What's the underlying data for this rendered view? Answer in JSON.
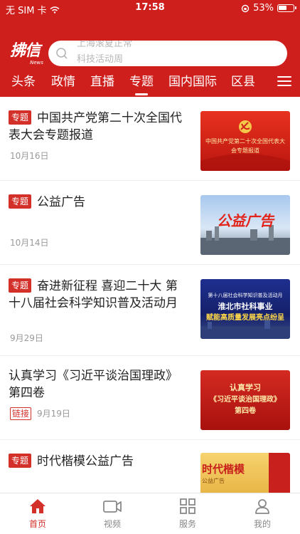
{
  "status_bar": {
    "carrier": "无 SIM 卡",
    "time": "17:58",
    "battery": "53%"
  },
  "logo": {
    "main": "拂信",
    "sub": "News"
  },
  "search": {
    "hints": [
      "上海滚夏正常",
      "科技活动周"
    ]
  },
  "nav": {
    "tabs": [
      {
        "label": "头条"
      },
      {
        "label": "政情"
      },
      {
        "label": "直播"
      },
      {
        "label": "专题"
      },
      {
        "label": "国内国际"
      },
      {
        "label": "区县"
      }
    ],
    "active": "专题"
  },
  "news": [
    {
      "badge": "专题",
      "title": "中国共产党第二十次全国代表大会专题报道",
      "date": "10月16日",
      "thumb": {
        "caption": "中国共产党第二十次全国代表大会专题报道",
        "bg": "#cf2418"
      }
    },
    {
      "badge": "专题",
      "title": "公益广告",
      "date": "10月14日",
      "thumb": {
        "caption": "公益广告",
        "bg": "#9fbfe6"
      }
    },
    {
      "badge": "专题",
      "title": "奋进新征程 喜迎二十大 第十八届社会科学知识普及活动月",
      "date": "9月29日",
      "thumb": {
        "caption_top": "第十八届社会科学知识普及活动月",
        "caption_main": "淮北市社科事业",
        "caption_sub": "赋能高质量发展亮点纷呈",
        "bg": "#1b2a7a"
      }
    },
    {
      "badge": "",
      "title": "认真学习《习近平谈治国理政》第四卷",
      "tag": "链接",
      "date": "9月19日",
      "thumb": {
        "caption_top": "认真学习",
        "caption_main": "《习近平谈治国理政》",
        "caption_sub": "第四卷",
        "bg": "#c8201c"
      }
    },
    {
      "badge": "专题",
      "title": "时代楷模公益广告",
      "date": "",
      "thumb": {
        "caption_main": "时代楷模",
        "caption_sub": "公益广告",
        "bg": "#f1c85a"
      }
    }
  ],
  "tabbar": [
    {
      "label": "首页",
      "icon": "home-icon"
    },
    {
      "label": "视频",
      "icon": "video-icon"
    },
    {
      "label": "服务",
      "icon": "grid-icon"
    },
    {
      "label": "我的",
      "icon": "user-icon"
    }
  ],
  "colors": {
    "brand_red": "#cf1f1d",
    "badge_red": "#d4302a"
  }
}
